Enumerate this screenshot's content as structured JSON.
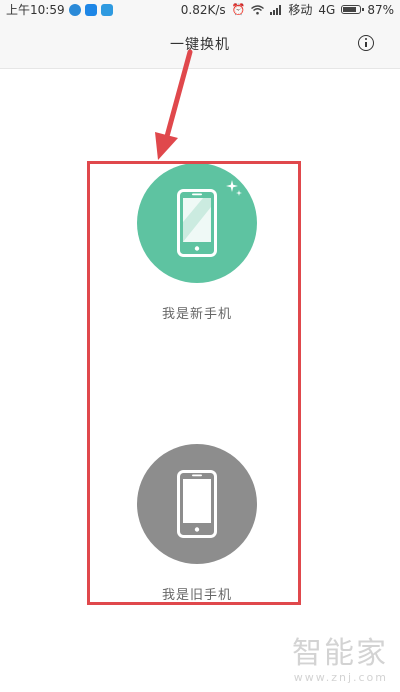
{
  "status_bar": {
    "time": "上午10:59",
    "net_speed": "0.82K/s",
    "carrier": "移动",
    "network": "4G",
    "battery": "87%",
    "battery_level": 0.87
  },
  "header": {
    "title": "一键换机",
    "info_icon": "info-circle-icon"
  },
  "options": {
    "new_phone": {
      "label": "我是新手机",
      "color": "#5ec3a1",
      "icon": "smartphone-sparkle-icon"
    },
    "old_phone": {
      "label": "我是旧手机",
      "color": "#8d8d8d",
      "icon": "smartphone-icon"
    }
  },
  "annotation": {
    "color": "#e0484c"
  },
  "watermark": {
    "logo": "智能家",
    "url": "www.znj.com"
  }
}
